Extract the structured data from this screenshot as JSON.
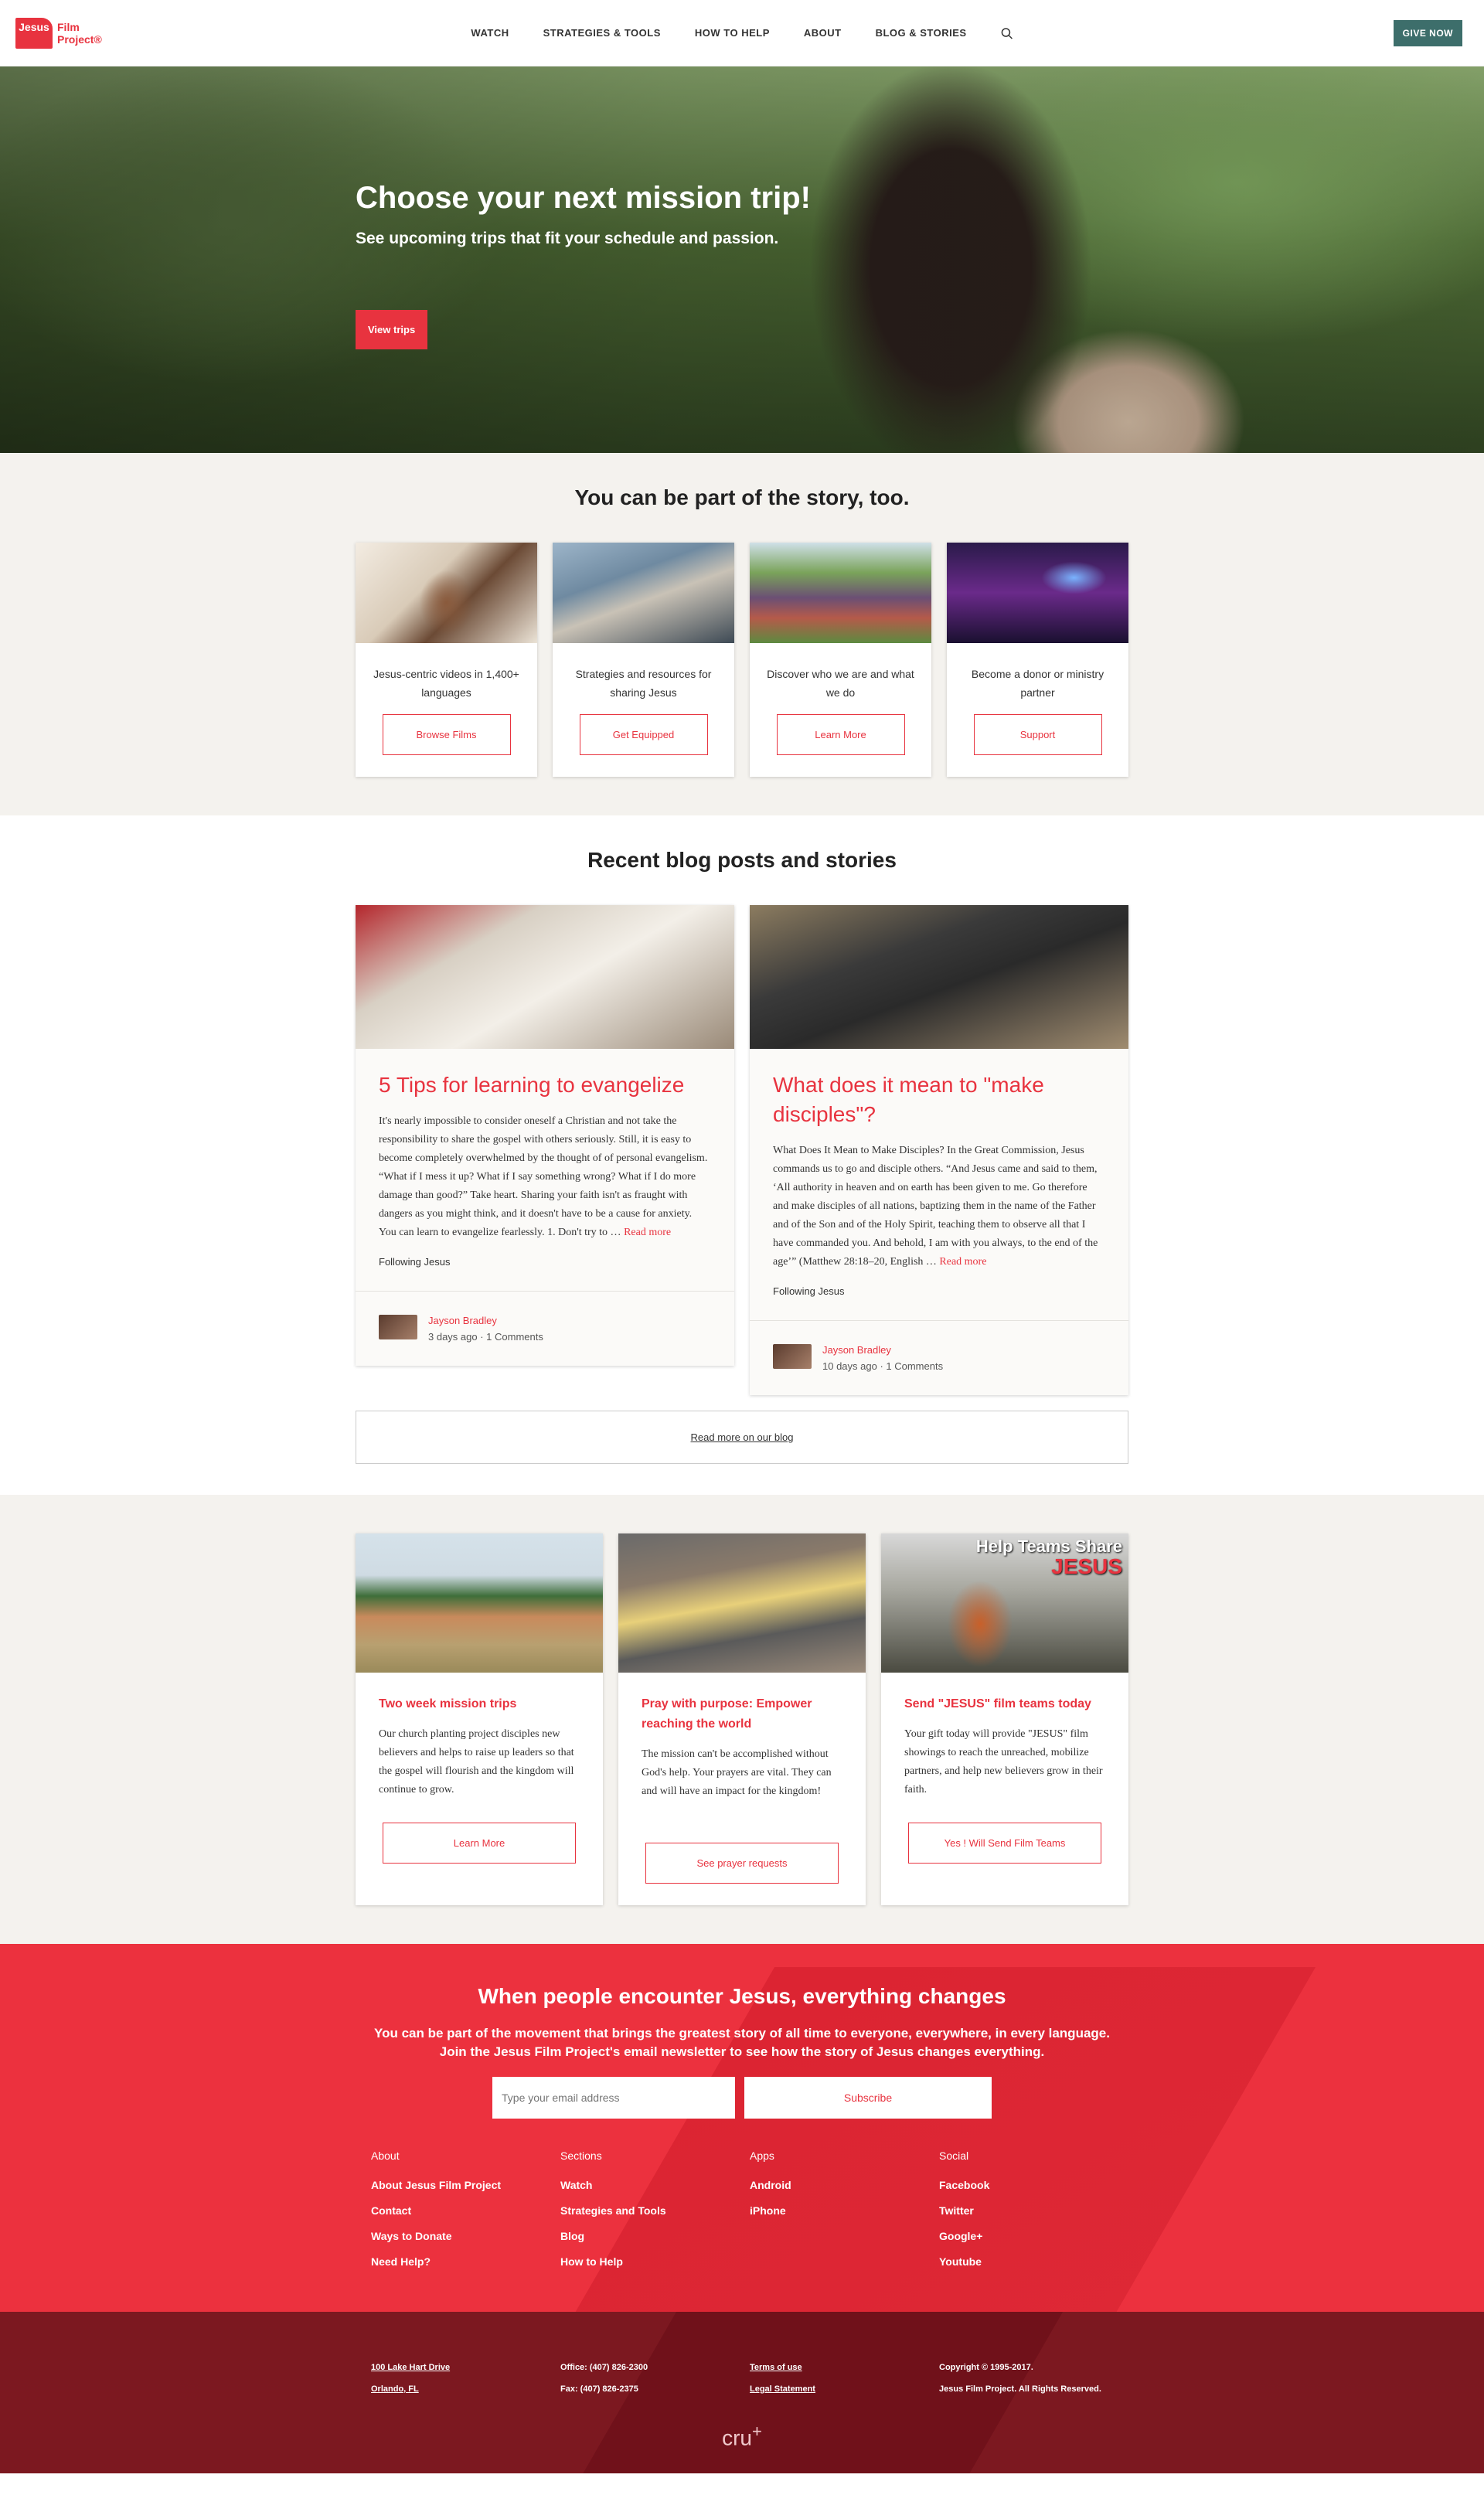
{
  "header": {
    "logo": {
      "mark": "Jesus",
      "line1": "Film",
      "line2": "Project®"
    },
    "nav": [
      "WATCH",
      "STRATEGIES & TOOLS",
      "HOW TO HELP",
      "ABOUT",
      "BLOG & STORIES"
    ],
    "give_label": "GIVE NOW"
  },
  "hero": {
    "title": "Choose your next mission trip!",
    "subtitle": "See upcoming trips that fit your schedule and passion.",
    "button": "View trips"
  },
  "story": {
    "title": "You can be part of the story, too.",
    "cards": [
      {
        "text": "Jesus-centric videos in 1,400+ languages",
        "button": "Browse Films"
      },
      {
        "text": "Strategies and resources for sharing Jesus",
        "button": "Get Equipped"
      },
      {
        "text": "Discover who we are and what we do",
        "button": "Learn More"
      },
      {
        "text": "Become a donor or ministry partner",
        "button": "Support"
      }
    ]
  },
  "blog": {
    "title": "Recent blog posts and stories",
    "posts": [
      {
        "title": "5 Tips for learning to evangelize",
        "excerpt": "It's nearly impossible to consider oneself a Christian and not take the responsibility to share the gospel with others seriously. Still, it is easy to become completely overwhelmed by the thought of of personal evangelism. “What if I mess it up? What if I say something wrong? What if I do more damage than good?” Take heart. Sharing your faith isn't as fraught with dangers as you might think, and it doesn't have to be a cause for anxiety. You can learn to evangelize fearlessly. 1. Don't try to …",
        "more": "Read more",
        "category": "Following Jesus",
        "author": "Jayson Bradley",
        "meta": "3 days ago · 1 Comments"
      },
      {
        "title": "What does it mean to \"make disciples\"?",
        "excerpt": "What Does It Mean to Make Disciples? In the Great Commission, Jesus commands us to go and disciple others. “And Jesus came and said to them, ‘All authority in heaven and on earth has been given to me. Go therefore and make disciples of all nations, baptizing them in the name of the Father and of the Son and of the Holy Spirit, teaching them to observe all that I have commanded you. And behold, I am with you always, to the end of the age’” (Matthew 28:18–20, English …",
        "more": "Read more",
        "category": "Following Jesus",
        "author": "Jayson Bradley",
        "meta": "10 days ago · 1 Comments"
      }
    ],
    "more_link": "Read more on our blog"
  },
  "promos": [
    {
      "title": "Two week mission trips",
      "desc": "Our church planting project disciples new believers and helps to raise up leaders so that the gospel will flourish and the kingdom will continue to grow.",
      "button": "Learn More"
    },
    {
      "title": "Pray with purpose: Empower reaching the world",
      "desc": "The mission can't be accomplished without God's help. Your prayers are vital. They can and will have an impact for the kingdom!",
      "button": "See prayer requests"
    },
    {
      "title": "Send \"JESUS\" film teams today",
      "desc": "Your gift today will provide \"JESUS\" film showings to reach the unreached, mobilize partners, and help new believers grow in their faith.",
      "button": "Yes ! Will Send Film Teams",
      "overlay1": "Help Teams Share",
      "overlay2": "JESUS"
    }
  ],
  "newsletter": {
    "title": "When people encounter Jesus, everything changes",
    "sub1": "You can be part of the movement that brings the greatest story of all time to everyone, everywhere, in every language.",
    "sub2": "Join the Jesus Film Project's email newsletter to see how the story of Jesus changes everything.",
    "placeholder": "Type your email address",
    "button": "Subscribe"
  },
  "footer": {
    "cols": [
      {
        "heading": "About",
        "links": [
          "About Jesus Film Project",
          "Contact",
          "Ways to Donate",
          "Need Help?"
        ]
      },
      {
        "heading": "Sections",
        "links": [
          "Watch",
          "Strategies and Tools",
          "Blog",
          "How to Help"
        ]
      },
      {
        "heading": "Apps",
        "links": [
          "Android",
          "iPhone"
        ]
      },
      {
        "heading": "Social",
        "links": [
          "Facebook",
          "Twitter",
          "Google+",
          "Youtube"
        ]
      }
    ],
    "bottom": {
      "address1": "100 Lake Hart Drive",
      "address2": "Orlando, FL",
      "office": "Office: (407) 826-2300",
      "fax": "Fax: (407) 826-2375",
      "terms": "Terms of use",
      "legal": "Legal Statement",
      "copyright1": "Copyright © 1995-2017.",
      "copyright2": "Jesus Film Project. All Rights Reserved.",
      "cru": "cru"
    }
  },
  "colors": {
    "accent": "#e8333f",
    "give": "#3d6e6b",
    "footer_dark": "#7c1820"
  }
}
